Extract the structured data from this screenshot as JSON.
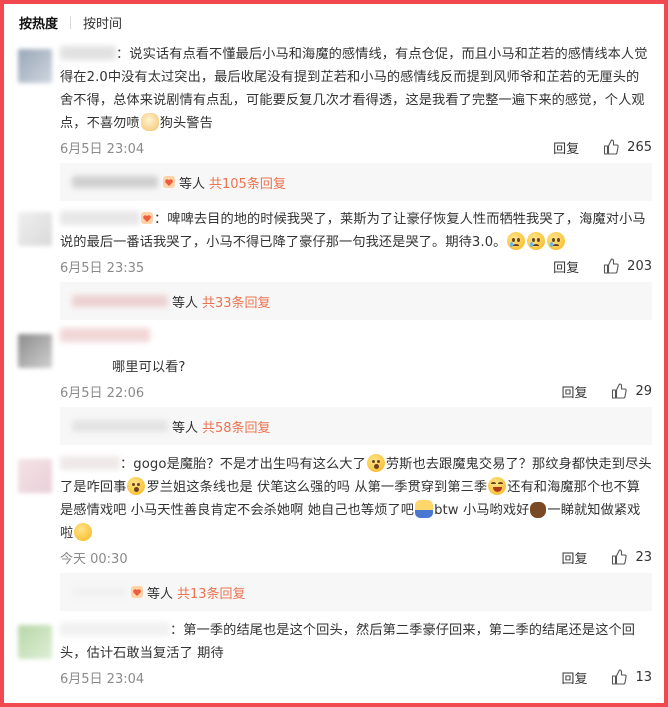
{
  "tabs": {
    "hot": "按热度",
    "time": "按时间"
  },
  "colors": {
    "accent": "#eb7350",
    "frame": "#f2484f",
    "sub_box_bg": "#f7f7f7"
  },
  "comments": [
    {
      "text": "说实话有点看不懂最后小马和海魔的感情线，有点仓促，而且小马和芷若的感情线本人觉得在2.0中没有太过突出，最后收尾没有提到芷若和小马的感情线反而提到风师爷和芷若的无厘头的舍不得，总体来说剧情有点乱，可能要反复几次才看得透，这是我看了完整一遍下来的感觉，个人观点，不喜勿喷",
      "text_after_emoji": "狗头警告",
      "time": "6月5日 23:04",
      "reply": "回复",
      "likes": "265",
      "sub": {
        "label": "等人",
        "link": "共105条回复"
      }
    },
    {
      "text": "啤啤去目的地的时候我哭了，莱斯为了让豪仔恢复人性而牺牲我哭了，海魔对小马说的最后一番话我哭了，小马不得已降了豪仔那一句我还是哭了。期待3.0。",
      "time": "6月5日 23:35",
      "reply": "回复",
      "likes": "203",
      "sub": {
        "label": "等人",
        "link": "共33条回复"
      }
    },
    {
      "text": "哪里可以看?",
      "time": "6月5日 22:06",
      "reply": "回复",
      "likes": "29",
      "sub": {
        "label": "等人",
        "link": "共58条回复"
      }
    },
    {
      "text_a": "gogo是魔胎？不是才出生吗有这么大了",
      "text_b": "劳斯也去跟魔鬼交易了？那纹身都快走到尽头了是咋回事",
      "text_c": "罗兰姐这条线也是 伏笔这么强的吗 从第一季贯穿到第三季",
      "text_d": "还有和海魔那个也不算是感情戏吧 小马天性善良肯定不会杀她啊 她自己也等烦了吧",
      "text_e": "btw 小马哟戏好",
      "text_f": "一睇就知做紧戏啦",
      "time": "今天 00:30",
      "reply": "回复",
      "likes": "23",
      "sub": {
        "label": "等人",
        "link": "共13条回复"
      }
    },
    {
      "text": "第一季的结尾也是这个回头，然后第二季豪仔回来，第二季的结尾还是这个回头，估计石敢当复活了 期待",
      "time": "6月5日 23:04",
      "reply": "回复",
      "likes": "13"
    }
  ]
}
